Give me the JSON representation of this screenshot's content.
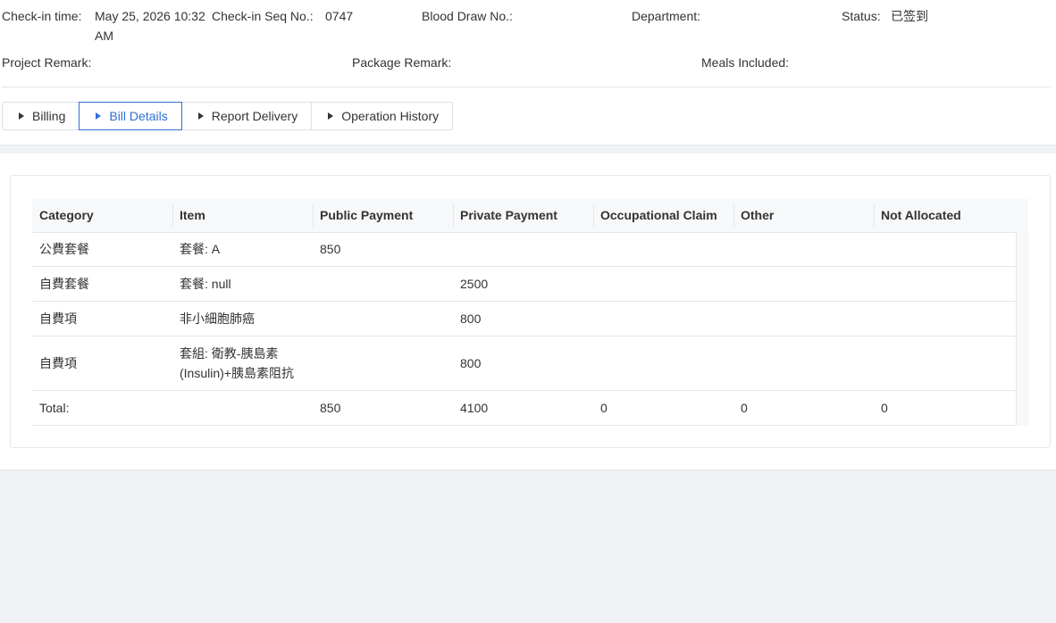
{
  "info": {
    "checkin_time_label": "Check-in time:",
    "checkin_time_value_line1": "May 25, 2026 10:32",
    "checkin_time_value_line2": "AM",
    "seq_label": "Check-in Seq No.:",
    "seq_value": "0747",
    "blood_label": "Blood Draw No.:",
    "blood_value": "",
    "dept_label": "Department:",
    "dept_value": "",
    "status_label": "Status:",
    "status_value": "已签到",
    "project_remark_label": "Project Remark:",
    "project_remark_value": "",
    "package_remark_label": "Package Remark:",
    "package_remark_value": "",
    "meals_label": "Meals Included:",
    "meals_value": ""
  },
  "tabs": [
    {
      "label": "Billing",
      "icon": "caret-right-icon"
    },
    {
      "label": "Bill Details",
      "icon": "caret-right-icon",
      "active": true
    },
    {
      "label": "Report Delivery",
      "icon": "caret-right-icon"
    },
    {
      "label": "Operation History",
      "icon": "caret-right-icon"
    }
  ],
  "table": {
    "columns": [
      "Category",
      "Item",
      "Public Payment",
      "Private Payment",
      "Occupational Claim",
      "Other",
      "Not Allocated"
    ],
    "rows": [
      {
        "category": "公費套餐",
        "item_line1": "套餐: A",
        "item_line2": "",
        "public": "850",
        "private": "",
        "occupational": "",
        "other": "",
        "not_allocated": ""
      },
      {
        "category": "自費套餐",
        "item_line1": "套餐: null",
        "item_line2": "",
        "public": "",
        "private": "2500",
        "occupational": "",
        "other": "",
        "not_allocated": ""
      },
      {
        "category": "自費項",
        "item_line1": "非小細胞肺癌",
        "item_line2": "",
        "public": "",
        "private": "800",
        "occupational": "",
        "other": "",
        "not_allocated": ""
      },
      {
        "category": "自費項",
        "item_line1": "套組: 衛教-胰島素",
        "item_line2": "(Insulin)+胰島素阻抗",
        "public": "",
        "private": "800",
        "occupational": "",
        "other": "",
        "not_allocated": ""
      }
    ],
    "total": {
      "label": "Total:",
      "public": "850",
      "private": "4100",
      "occupational": "0",
      "other": "0",
      "not_allocated": "0"
    }
  },
  "colors": {
    "accent": "#2f6fd6",
    "border": "#e5e6eb",
    "background_gray": "#f0f1f5"
  }
}
